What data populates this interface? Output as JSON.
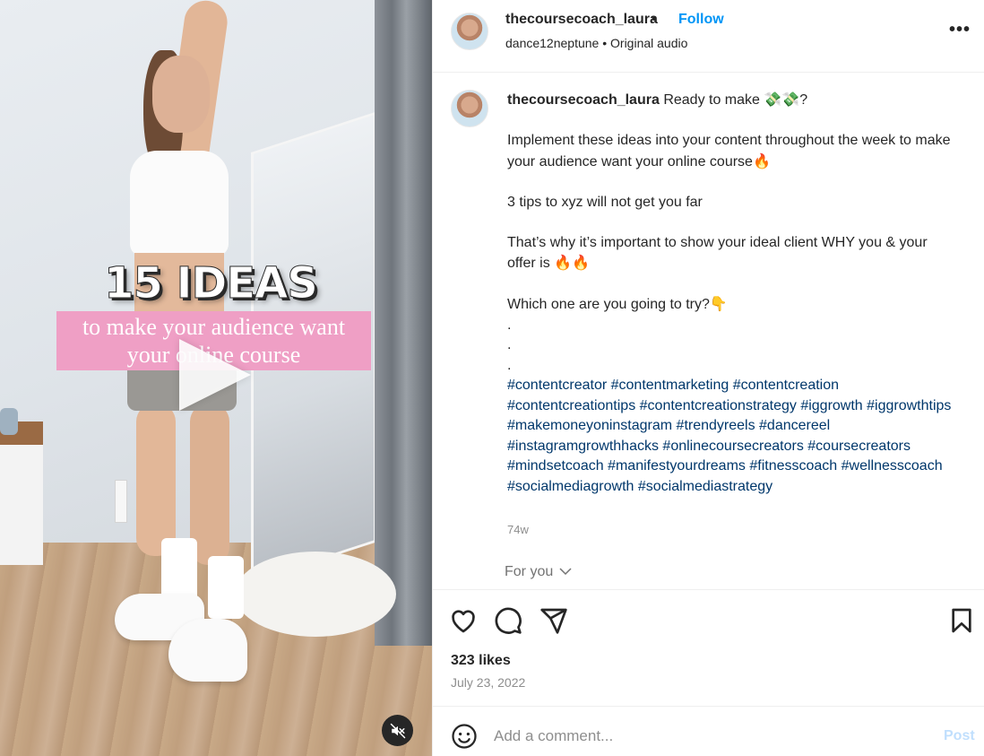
{
  "header": {
    "username": "thecoursecoach_laura",
    "separator": "•",
    "follow_label": "Follow",
    "audio_artist": "dance12neptune",
    "audio_separator": "•",
    "audio_track": "Original audio",
    "more_icon": "more-horizontal-icon",
    "more_label": "•••"
  },
  "media": {
    "title": "15 IDEAS",
    "subtitle_line1": "to make your audience want",
    "subtitle_line2": "your online course",
    "play_icon": "play-icon",
    "mute_icon": "speaker-muted-icon"
  },
  "caption": {
    "username": "thecoursecoach_laura",
    "line1_text": "Ready to make",
    "line1_emoji": "💸💸",
    "line1_end": "?",
    "para1": "Implement these ideas into your content throughout the week to make your audience want your online course",
    "para1_emoji": "🔥",
    "para2": "3 tips to xyz will not get you far",
    "para3": "That’s why it’s important to show your ideal client WHY you & your offer is",
    "para3_emoji": "🔥🔥",
    "para4": "Which one are you going to try?",
    "para4_emoji": "👇",
    "dots": [
      ".",
      ".",
      "."
    ],
    "hashtags": "#contentcreator #contentmarketing #contentcreation #contentcreationtips #contentcreationstrategy #iggrowth #iggrowthtips #makemoneyoninstagram #trendyreels #dancereel #instagramgrowthhacks #onlinecoursecreators #coursecreators #mindsetcoach #manifestyourdreams #fitnesscoach #wellnesscoach #socialmediagrowth #socialmediastrategy",
    "timestamp": "74w",
    "for_you": "For you"
  },
  "actions": {
    "like_icon": "heart-icon",
    "comment_icon": "comment-icon",
    "share_icon": "send-icon",
    "save_icon": "bookmark-icon",
    "likes": "323 likes",
    "date": "July 23, 2022"
  },
  "comment": {
    "emoji_icon": "smiley-icon",
    "placeholder": "Add a comment...",
    "post_label": "Post"
  },
  "colors": {
    "link_blue": "#0095f6",
    "hashtag_blue": "#00376b",
    "muted_gray": "#8e8e8e",
    "overlay_pink": "#ef9fc5",
    "post_disabled": "#c0dffd"
  }
}
